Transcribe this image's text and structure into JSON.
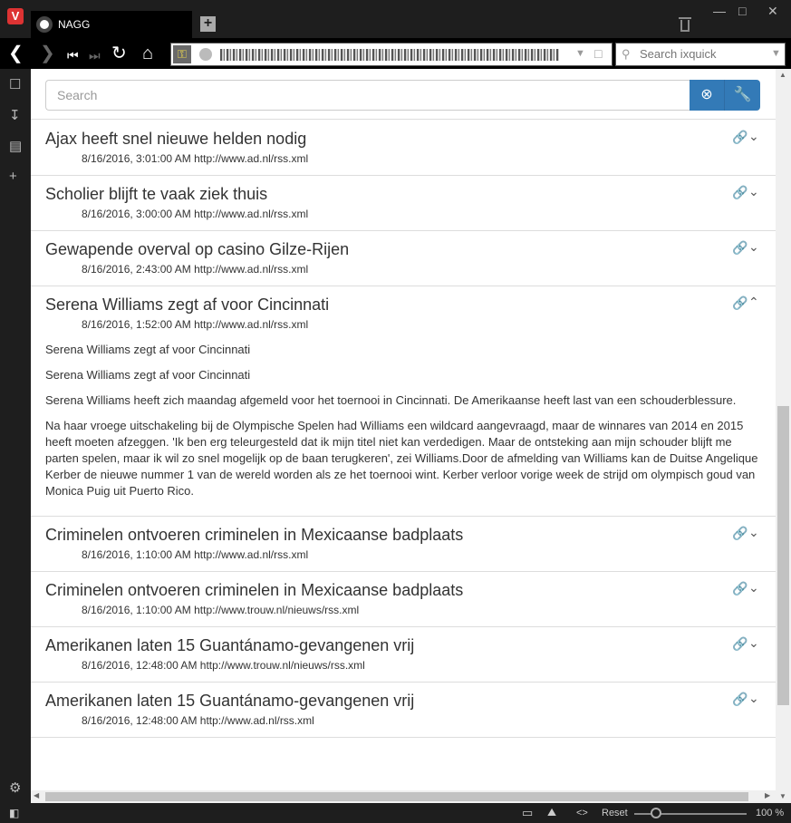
{
  "browser": {
    "tab_title": "NAGG",
    "search_placeholder": "Search ixquick",
    "zoom_label": "100 %",
    "reset_label": "Reset"
  },
  "app": {
    "search_placeholder": "Search"
  },
  "items": [
    {
      "title": "Ajax heeft snel nieuwe helden nodig",
      "meta": "8/16/2016, 3:01:00 AM http://www.ad.nl/rss.xml"
    },
    {
      "title": "Scholier blijft te vaak ziek thuis",
      "meta": "8/16/2016, 3:00:00 AM http://www.ad.nl/rss.xml"
    },
    {
      "title": "Gewapende overval op casino Gilze-Rijen",
      "meta": "8/16/2016, 2:43:00 AM http://www.ad.nl/rss.xml"
    },
    {
      "title": "Serena Williams zegt af voor Cincinnati",
      "meta": "8/16/2016, 1:52:00 AM http://www.ad.nl/rss.xml",
      "body": [
        "Serena Williams zegt af voor Cincinnati",
        "Serena Williams zegt af voor Cincinnati",
        "Serena Williams heeft zich maandag afgemeld voor het toernooi in Cincinnati. De Amerikaanse heeft last van een schouderblessure.",
        "Na haar vroege uitschakeling bij de Olympische Spelen had Williams een wildcard aangevraagd, maar de winnares van 2014 en 2015 heeft moeten afzeggen. 'Ik ben erg teleurgesteld dat ik mijn titel niet kan verdedigen. Maar de ontsteking aan mijn schouder blijft me parten spelen, maar ik wil zo snel mogelijk op de baan terugkeren', zei Williams.Door de afmelding van Williams kan de Duitse Angelique Kerber de nieuwe nummer 1 van de wereld worden als ze het toernooi wint. Kerber verloor vorige week de strijd om olympisch goud van Monica Puig uit Puerto Rico."
      ]
    },
    {
      "title": "Criminelen ontvoeren criminelen in Mexicaanse badplaats",
      "meta": "8/16/2016, 1:10:00 AM http://www.ad.nl/rss.xml"
    },
    {
      "title": "Criminelen ontvoeren criminelen in Mexicaanse badplaats",
      "meta": "8/16/2016, 1:10:00 AM http://www.trouw.nl/nieuws/rss.xml"
    },
    {
      "title": "Amerikanen laten 15 Guantánamo-gevangenen vrij",
      "meta": "8/16/2016, 12:48:00 AM http://www.trouw.nl/nieuws/rss.xml"
    },
    {
      "title": "Amerikanen laten 15 Guantánamo-gevangenen vrij",
      "meta": "8/16/2016, 12:48:00 AM http://www.ad.nl/rss.xml"
    }
  ]
}
